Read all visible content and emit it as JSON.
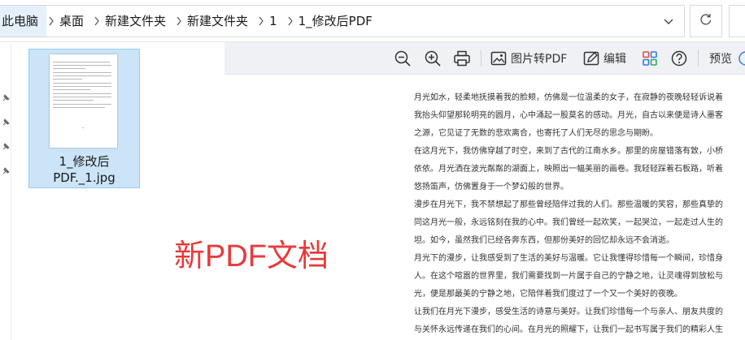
{
  "address_bar": {
    "crumbs": [
      "此电脑",
      "桌面",
      "新建文件夹",
      "新建文件夹",
      "1",
      "1_修改后PDF"
    ]
  },
  "icons": {
    "separator": "chevron-right-icon",
    "dropdown": "chevron-down-icon",
    "refresh": "refresh-icon",
    "pin": "pin-icon"
  },
  "file": {
    "name_line1": "1_修改后",
    "name_line2": "PDF._1.jpg",
    "selected": true
  },
  "preview_toolbar": {
    "zoom_out": "zoom-out-icon",
    "zoom_in": "zoom-in-icon",
    "print": "print-icon",
    "to_pdf_label": "图片转PDF",
    "edit_label": "编辑",
    "preview_label": "预览"
  },
  "document": {
    "lines": [
      "月光如水，轻柔地抚摸着我的脸颊，仿佛是一位温柔的女子，在寂静的夜晚轻轻诉说着她的故事。",
      "我抬头仰望那轮明亮的圆月，心中涌起一股莫名的感动。月光，自古以来便是诗人墨客笔下的灵感",
      "之源，它见证了无数的悲欢离合，也寄托了人们无尽的思念与期盼。",
      "在这月光下，我仿佛穿越了时空，来到了古代的江南水乡。那里的房屋错落有致，小桥流水，杨柳",
      "依依。月光洒在波光粼粼的湖面上，映照出一幅美丽的画卷。我轻轻踩着石板路，听着远处传来的",
      "悠扬笛声，仿佛置身于一个梦幻般的世界。",
      "漫步在月光下，我不禁想起了那些曾经陪伴过我的人们。那些温暖的笑容，那些真挚的情感，都如",
      "同这月光一般，永远铭刻在我的心中。我们曾经一起欢笑，一起哭泣，一起走过人生的坎坷与平",
      "坦。如今，虽然我们已经各奔东西，但那份美好的回忆却永远不会消逝。",
      "月光下的漫步，让我感受到了生活的美好与温暖。它让我懂得珍惜每一个瞬间，珍惜身边的每一个",
      "人。在这个喧嚣的世界里，我们需要找到一片属于自己的宁静之地，让灵魂得到放松与滋养。而月",
      "光，便是那最美的宁静之地，它陪伴着我们度过了一个又一个美好的夜晚。",
      "让我们在月光下漫步，感受生活的诗意与美好。让我们珍惜每一个与亲人、朋友共度的时光，让爱",
      "与关怀永远传递在我们的心间。在月光的照耀下，让我们一起书写属于我们的精彩人生。"
    ]
  },
  "overlay_text": "新PDF文档",
  "colors": {
    "selection_bg": "#cce4f7",
    "selection_border": "#99c9ef",
    "overlay_red": "#e83a3a",
    "toolbar_bg": "#f0f1f4"
  }
}
